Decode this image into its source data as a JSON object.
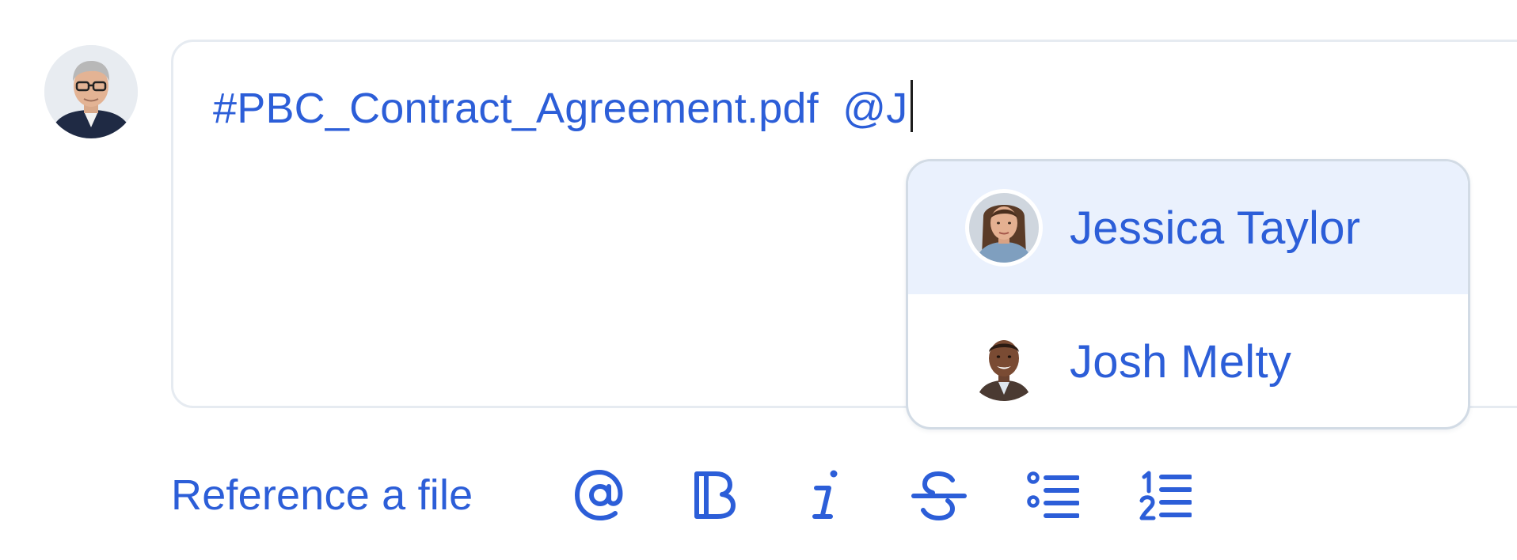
{
  "composer": {
    "text": "#PBC_Contract_Agreement.pdf  @J"
  },
  "mention_popup": {
    "items": [
      {
        "name": "Jessica Taylor",
        "highlighted": true
      },
      {
        "name": "Josh Melty",
        "highlighted": false
      }
    ]
  },
  "toolbar": {
    "reference_label": "Reference a file",
    "icons": [
      "at-sign-icon",
      "bold-icon",
      "italic-icon",
      "strikethrough-icon",
      "bullet-list-icon",
      "numbered-list-icon"
    ]
  },
  "colors": {
    "accent": "#2c5ed8",
    "highlight": "#eaf1fd",
    "border": "#e6ebf1"
  }
}
